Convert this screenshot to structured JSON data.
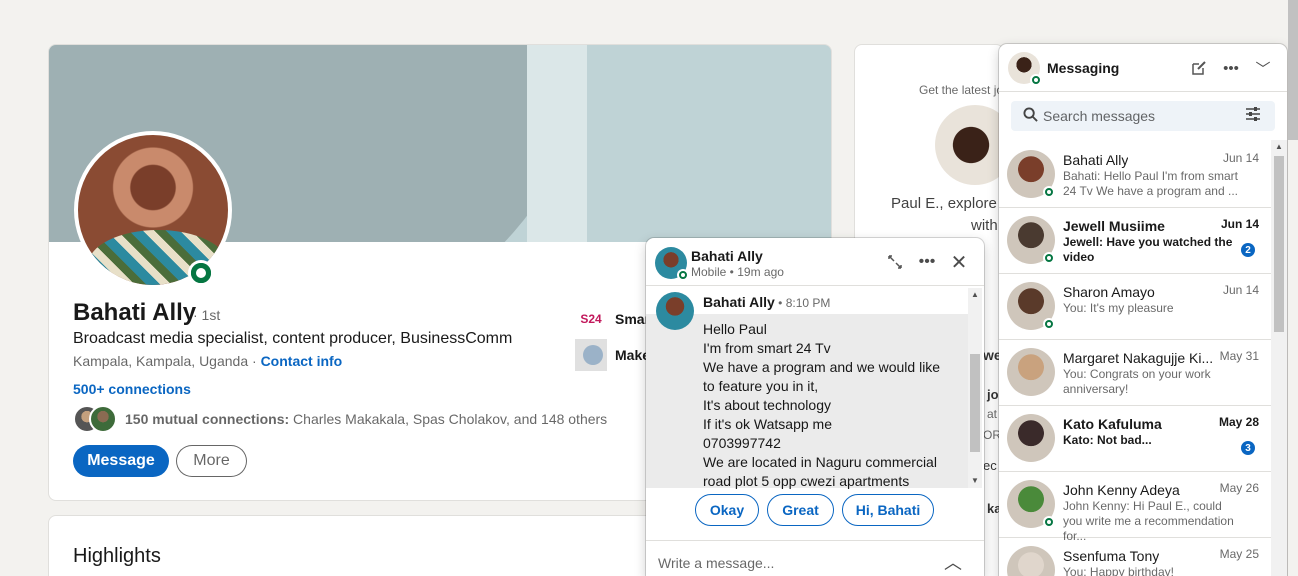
{
  "profile": {
    "name": "Bahati Ally",
    "degree": "· 1st",
    "headline": "Broadcast media specialist, content producer, BusinessComm",
    "location": "Kampala, Kampala, Uganda · ",
    "contact_info": "Contact info",
    "connections": "500+ connections",
    "mutual_bold": "150 mutual connections:",
    "mutual_rest": " Charles Makakala, Spas Cholakov, and 148 others",
    "message_button": "Message",
    "more_button": "More",
    "companies": [
      {
        "logo": "S24",
        "name": "Smar"
      },
      {
        "name": "Make"
      }
    ]
  },
  "highlights": {
    "title": "Highlights"
  },
  "ad": {
    "small": "Get the latest jo",
    "line1": "Paul E., explore r",
    "line2": "with"
  },
  "peek_texts": [
    "we",
    "jo",
    "at",
    "OR",
    "ec",
    "ka"
  ],
  "chat": {
    "name": "Bahati Ally",
    "status": "Mobile  •  19m ago",
    "message": {
      "sender": "Bahati Ally",
      "time": " • 8:10 PM",
      "lines": [
        "Hello Paul",
        "I'm from smart 24 Tv",
        "We have a program and we would like",
        "to feature you in it,",
        "It's about technology",
        "If it's ok Watsapp me",
        "0703997742",
        "We are located in Naguru commercial",
        "road plot 5 opp cwezi apartments"
      ]
    },
    "quick_replies": [
      "Okay",
      "Great",
      "Hi, Bahati"
    ],
    "input_placeholder": "Write a message..."
  },
  "messaging": {
    "title": "Messaging",
    "search_placeholder": "Search messages",
    "conversations": [
      {
        "name": "Bahati Ally",
        "date": "Jun 14",
        "snippet": "Bahati: Hello Paul I'm from smart 24 Tv We have a program and ...",
        "unread": false,
        "online": true,
        "color": "#7a3e2a"
      },
      {
        "name": "Jewell Musiime",
        "date": "Jun 14",
        "snippet": "Jewell: Have you watched the video",
        "unread": true,
        "badge": "2",
        "online": true,
        "color": "#4a3a30"
      },
      {
        "name": "Sharon Amayo",
        "date": "Jun 14",
        "snippet": "You: It's my pleasure",
        "unread": false,
        "online": true,
        "color": "#5a3a2a"
      },
      {
        "name": "Margaret Nakagujje Ki...",
        "date": "May 31",
        "snippet": "You: Congrats on your work anniversary!",
        "unread": false,
        "online": false,
        "color": "#c9a27e"
      },
      {
        "name": "Kato Kafuluma",
        "date": "May 28",
        "snippet": "Kato: Not bad...",
        "unread": true,
        "badge": "3",
        "online": false,
        "color": "#3a2a2a"
      },
      {
        "name": "John Kenny Adeya",
        "date": "May 26",
        "snippet": "John Kenny: Hi Paul E., could you write me a recommendation for...",
        "unread": false,
        "online": true,
        "color": "#4a8a3a"
      },
      {
        "name": "Ssenfuma Tony",
        "date": "May 25",
        "snippet": "You: Happy birthday!",
        "unread": false,
        "online": false,
        "color": "#e0d6cc"
      }
    ]
  }
}
